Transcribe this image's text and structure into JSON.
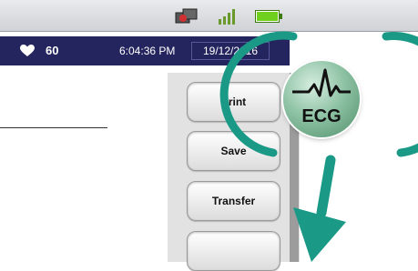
{
  "status_bar": {
    "icons": [
      "network-error-icon",
      "signal-strength-icon",
      "battery-icon"
    ],
    "colors": {
      "signal": "#6a9a2c",
      "battery": "#6fd11e",
      "error": "#d23030"
    }
  },
  "patient_bar": {
    "heart_rate": "60",
    "time": "6:04:36 PM",
    "date": "19/12/2016",
    "background": "#24255e"
  },
  "side_menu": {
    "print_label": "Print",
    "save_label": "Save",
    "transfer_label": "Transfer"
  },
  "ecg_badge": {
    "label": "ECG",
    "accent": "#1a9a86"
  }
}
